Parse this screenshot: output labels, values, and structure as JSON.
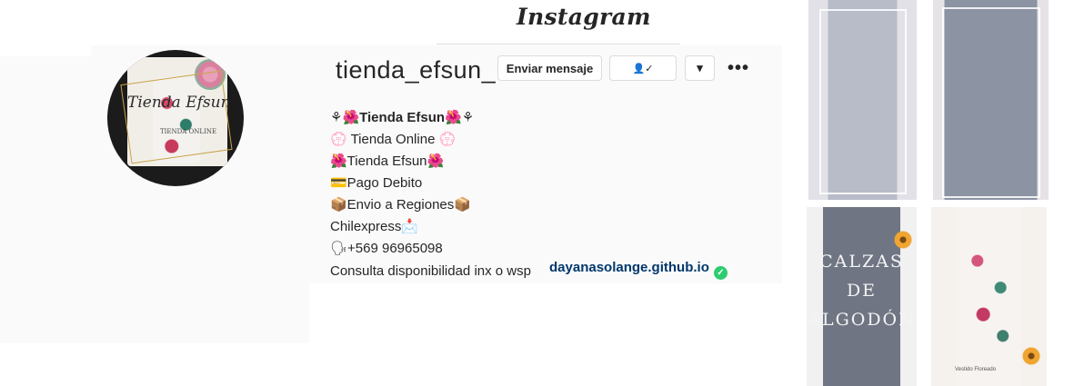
{
  "header": {
    "logo_text": "Instagram"
  },
  "avatar": {
    "title": "Tienda Efsun",
    "subtitle": "TIENDA ONLINE"
  },
  "profile": {
    "username": "tienda_efsun_",
    "send_message_label": "Enviar mensaje",
    "following_label": "👤✓",
    "dropdown_label": "▾",
    "more_label": "•••"
  },
  "bio": {
    "lines": [
      "⚘🌺",
      "Tienda Efsun",
      "🌺⚘",
      "💮 Tienda Online 💮",
      "🌺Tienda Efsun🌺",
      "💳Pago Debito",
      "📦Envio a Regiones📦",
      "Chilexpress📩",
      "🗣+569 96965098"
    ],
    "last_line": "Consulta disponibilidad inx o wsp",
    "link": "dayanasolange.github.io",
    "verified_mark": "✓"
  },
  "posts": [
    {
      "label": ""
    },
    {
      "label": ""
    },
    {
      "label": "CALZAS DE ALGODÓN"
    },
    {
      "caption": "Vestido Floreado"
    }
  ]
}
